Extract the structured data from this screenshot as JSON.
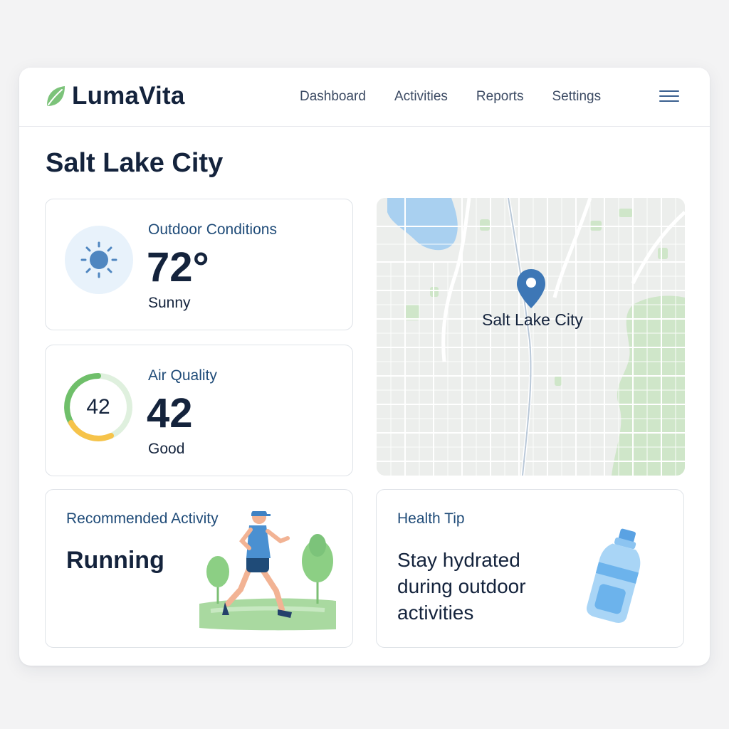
{
  "app": {
    "brand": "LumaVita",
    "brand_icon": "leaf-icon",
    "accent": "#6db36b"
  },
  "nav": {
    "items": [
      {
        "label": "Dashboard"
      },
      {
        "label": "Activities"
      },
      {
        "label": "Reports"
      },
      {
        "label": "Settings"
      }
    ],
    "menu_icon": "hamburger-menu-icon"
  },
  "page": {
    "title": "Salt Lake City"
  },
  "outdoor": {
    "label": "Outdoor Conditions",
    "temperature": "72°",
    "condition": "Sunny",
    "icon": "sun-icon"
  },
  "air_quality": {
    "label": "Air Quality",
    "value": "42",
    "status": "Good",
    "ring_fraction": 0.42,
    "ring_colors": {
      "good": "#6fbf6a",
      "moderate": "#f6c34a",
      "track": "#dff0de"
    }
  },
  "map": {
    "location_label": "Salt Lake City",
    "pin_icon": "map-pin-icon",
    "pin_color": "#3d77b6"
  },
  "activity": {
    "label": "Recommended Activity",
    "name": "Running",
    "illustration": "runner-illustration"
  },
  "health_tip": {
    "label": "Health Tip",
    "text": "Stay hydrated during outdoor activities",
    "illustration": "water-bottle-icon"
  }
}
